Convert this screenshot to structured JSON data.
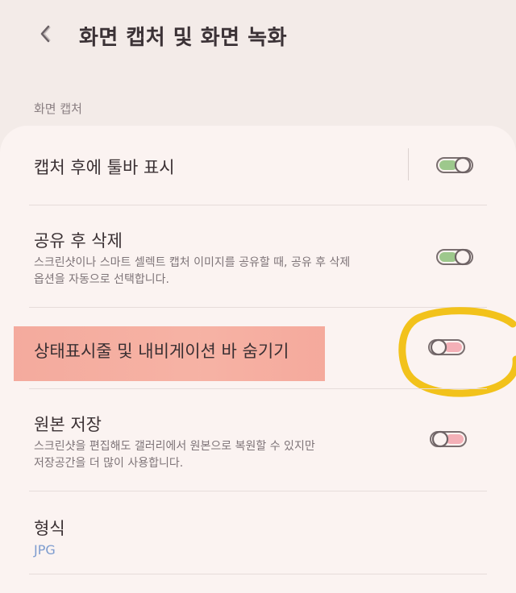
{
  "header": {
    "title": "화면 캡처 및 화면 녹화",
    "back_icon": "chevron-left-icon"
  },
  "section": {
    "label": "화면 캡처"
  },
  "settings": [
    {
      "title": "캡처 후에 툴바 표시",
      "description": "",
      "toggle_on": true
    },
    {
      "title": "공유 후 삭제",
      "description_line1": "스크린샷이나 스마트 셀렉트 캡처 이미지를 공유할 때, 공유 후 삭제",
      "description_line2": "옵션을 자동으로 선택합니다.",
      "toggle_on": true
    },
    {
      "title": "상태표시줄 및 내비게이션 바 숨기기",
      "description": "",
      "toggle_on": false,
      "highlighted": true
    },
    {
      "title": "원본 저장",
      "description_line1": "스크린샷을 편집해도 갤러리에서 원본으로 복원할 수 있지만",
      "description_line2": "저장공간을 더 많이 사용합니다.",
      "toggle_on": false
    },
    {
      "title": "형식",
      "value": "JPG"
    }
  ],
  "colors": {
    "toggle_on_fill": "#8cc07a",
    "toggle_off_fill": "#f2a3ad",
    "highlight": "#f6ad9e",
    "annotation": "#f2c21b",
    "value_text": "#7d9ccf"
  }
}
